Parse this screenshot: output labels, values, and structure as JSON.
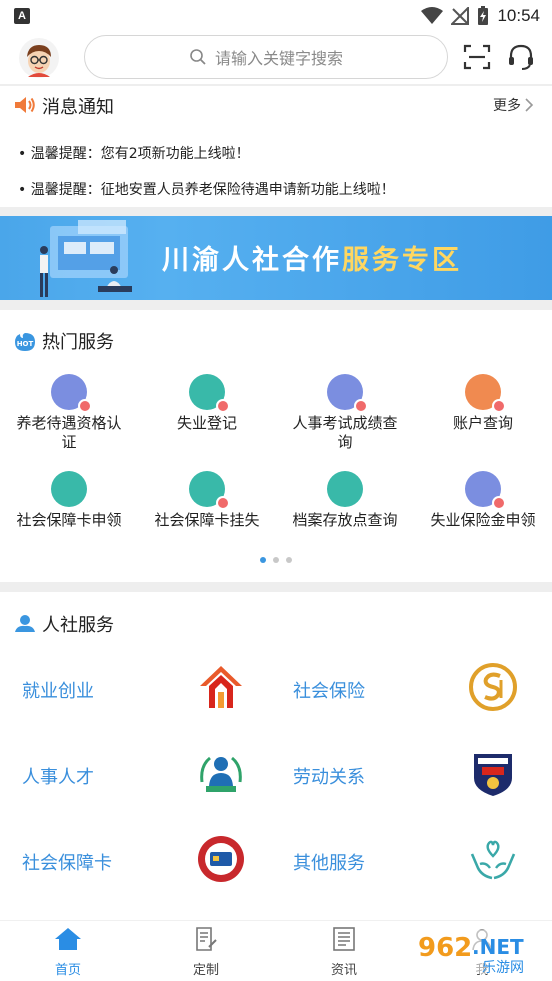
{
  "status_bar": {
    "time": "10:54",
    "left_icon": "A"
  },
  "header": {
    "search_placeholder": "请输入关键字搜索",
    "icons": [
      "avatar",
      "scan-icon",
      "customer-service-icon"
    ]
  },
  "notice": {
    "title": "消息通知",
    "more_label": "更多",
    "items": [
      "• 温馨提醒：您有2项新功能上线啦！",
      "• 温馨提醒：征地安置人员养老保险待遇申请新功能上线啦！"
    ]
  },
  "banner": {
    "text_main": "川渝人社合作",
    "text_highlight": "服务专区"
  },
  "hot_services": {
    "title": "热门服务",
    "hot_badge": "HOT",
    "items": [
      {
        "label": "养老待遇资格认证",
        "color": "#7b8ee0"
      },
      {
        "label": "失业登记",
        "color": "#39b9a9"
      },
      {
        "label": "人事考试成绩查询",
        "color": "#7b8ee0"
      },
      {
        "label": "账户查询",
        "color": "#f08a50"
      },
      {
        "label": "社会保障卡申领",
        "color": "#39b9a9"
      },
      {
        "label": "社会保障卡挂失",
        "color": "#39b9a9"
      },
      {
        "label": "档案存放点查询",
        "color": "#39b9a9"
      },
      {
        "label": "失业保险金申领",
        "color": "#7b8ee0"
      }
    ],
    "pager": {
      "pages": 3,
      "active": 1
    }
  },
  "renshe_services": {
    "title": "人社服务",
    "items": [
      {
        "label": "就业创业"
      },
      {
        "label": "社会保险"
      },
      {
        "label": "人事人才"
      },
      {
        "label": "劳动关系"
      },
      {
        "label": "社会保障卡"
      },
      {
        "label": "其他服务"
      }
    ]
  },
  "bottom_nav": {
    "items": [
      {
        "label": "首页",
        "active": true
      },
      {
        "label": "定制",
        "active": false
      },
      {
        "label": "资讯",
        "active": false
      },
      {
        "label": "我",
        "active": false
      }
    ]
  },
  "watermark": {
    "text_962": "962",
    "text_net": ".NET",
    "text_site": "乐游网"
  },
  "colors": {
    "accent": "#2a8de4",
    "link_blue": "#3a8fdc",
    "banner_bg": "#4aa6ea",
    "banner_highlight": "#ffd760"
  }
}
